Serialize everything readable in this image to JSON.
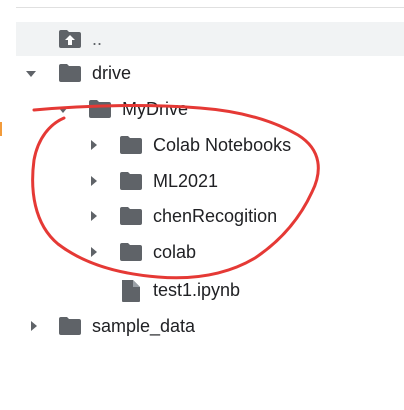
{
  "file_tree": {
    "parent_label": "..",
    "items": [
      {
        "label": "drive",
        "kind": "folder",
        "expanded": true
      },
      {
        "label": "MyDrive",
        "kind": "folder",
        "expanded": true
      },
      {
        "label": "Colab Notebooks",
        "kind": "folder",
        "expanded": false
      },
      {
        "label": "ML2021",
        "kind": "folder",
        "expanded": false
      },
      {
        "label": "chenRecogition",
        "kind": "folder",
        "expanded": false
      },
      {
        "label": "colab",
        "kind": "folder",
        "expanded": false
      },
      {
        "label": "test1.ipynb",
        "kind": "file"
      },
      {
        "label": "sample_data",
        "kind": "folder",
        "expanded": false
      }
    ]
  },
  "colors": {
    "icon": "#5f6368",
    "text": "#202124",
    "annotation": "#e53935",
    "row_highlight": "#f1f3f4"
  }
}
